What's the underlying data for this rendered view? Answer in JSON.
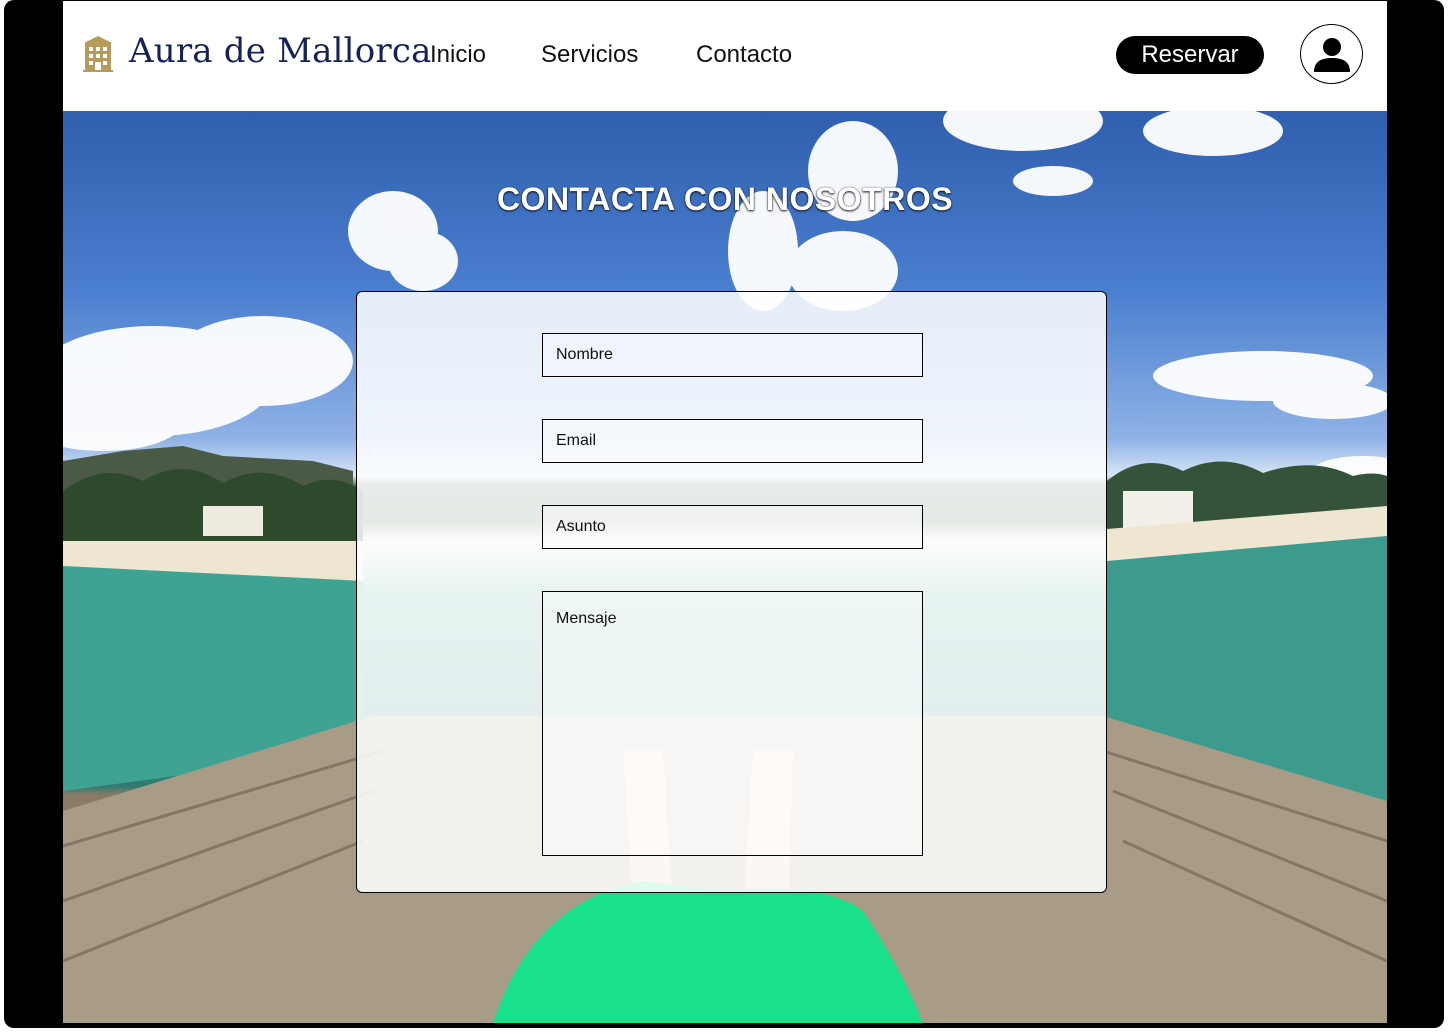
{
  "header": {
    "brand": "Aura de Mallorca",
    "logo_icon": "hotel-building-icon",
    "nav": [
      {
        "label": "Inicio"
      },
      {
        "label": "Servicios"
      },
      {
        "label": "Contacto"
      }
    ],
    "reserve_label": "Reservar",
    "avatar_icon": "user-icon"
  },
  "hero": {
    "title": "CONTACTA CON NOSOTROS"
  },
  "form": {
    "name_placeholder": "Nombre",
    "email_placeholder": "Email",
    "subject_placeholder": "Asunto",
    "message_placeholder": "Mensaje"
  },
  "colors": {
    "brand": "#14215a",
    "logo": "#b89a5a",
    "button": "#000000",
    "accent_shorts": "#19e08a"
  }
}
